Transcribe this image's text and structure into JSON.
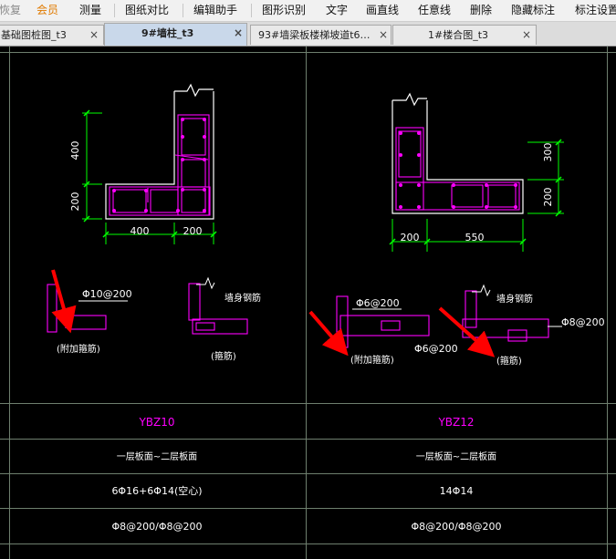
{
  "menu": {
    "items": [
      "恢复",
      "会员",
      "测量",
      "图纸对比",
      "编辑助手",
      "图形识别",
      "文字",
      "画直线",
      "任意线",
      "删除",
      "隐藏标注",
      "标注设置"
    ]
  },
  "tabs": [
    {
      "label": "基础图桩图_t3",
      "close": "×",
      "active": false
    },
    {
      "label": "9#墙柱_t3",
      "close": "×",
      "active": true
    },
    {
      "label": "93#墙梁板楼梯坡道t6…",
      "close": "×",
      "active": false
    },
    {
      "label": "1#楼合图_t3",
      "close": "×",
      "active": false
    }
  ],
  "drawing": {
    "colors": {
      "background": "#000000",
      "outline": "#ffffff",
      "rebar": "#ff00ff",
      "dimension": "#00ff00",
      "grid": "#6e7f6e",
      "arrow": "#ff0000",
      "text": "#ffffff",
      "label": "#ff00ff"
    },
    "left": {
      "dims": {
        "vertical_top": "400",
        "vertical_bottom": "200",
        "horizontal_left": "400",
        "horizontal_right": "200"
      },
      "stirrup_label": "Φ10@200",
      "extra_stirrup_note": "(附加箍筋)",
      "wall_rebar_label": "墙身钢筋",
      "stirrup_note": "(箍筋)"
    },
    "right": {
      "dims": {
        "vertical_top": "300",
        "vertical_bottom": "200",
        "horizontal_left": "200",
        "horizontal_right": "550"
      },
      "stirrup_label_1": "Φ6@200",
      "stirrup_label_2": "Φ6@200",
      "extra_stirrup_note": "(附加箍筋)",
      "wall_rebar_label": "墙身钢筋",
      "stirrup_label_3": "Φ8@200",
      "stirrup_note": "(箍筋)"
    },
    "table": {
      "rows": [
        {
          "left": "YBZ10",
          "right": "YBZ12"
        },
        {
          "left": "一层板面~二层板面",
          "right": "一层板面~二层板面"
        },
        {
          "left": "6Φ16+6Φ14(空心)",
          "right": "14Φ14"
        },
        {
          "left": "Φ8@200/Φ8@200",
          "right": "Φ8@200/Φ8@200"
        }
      ]
    }
  }
}
